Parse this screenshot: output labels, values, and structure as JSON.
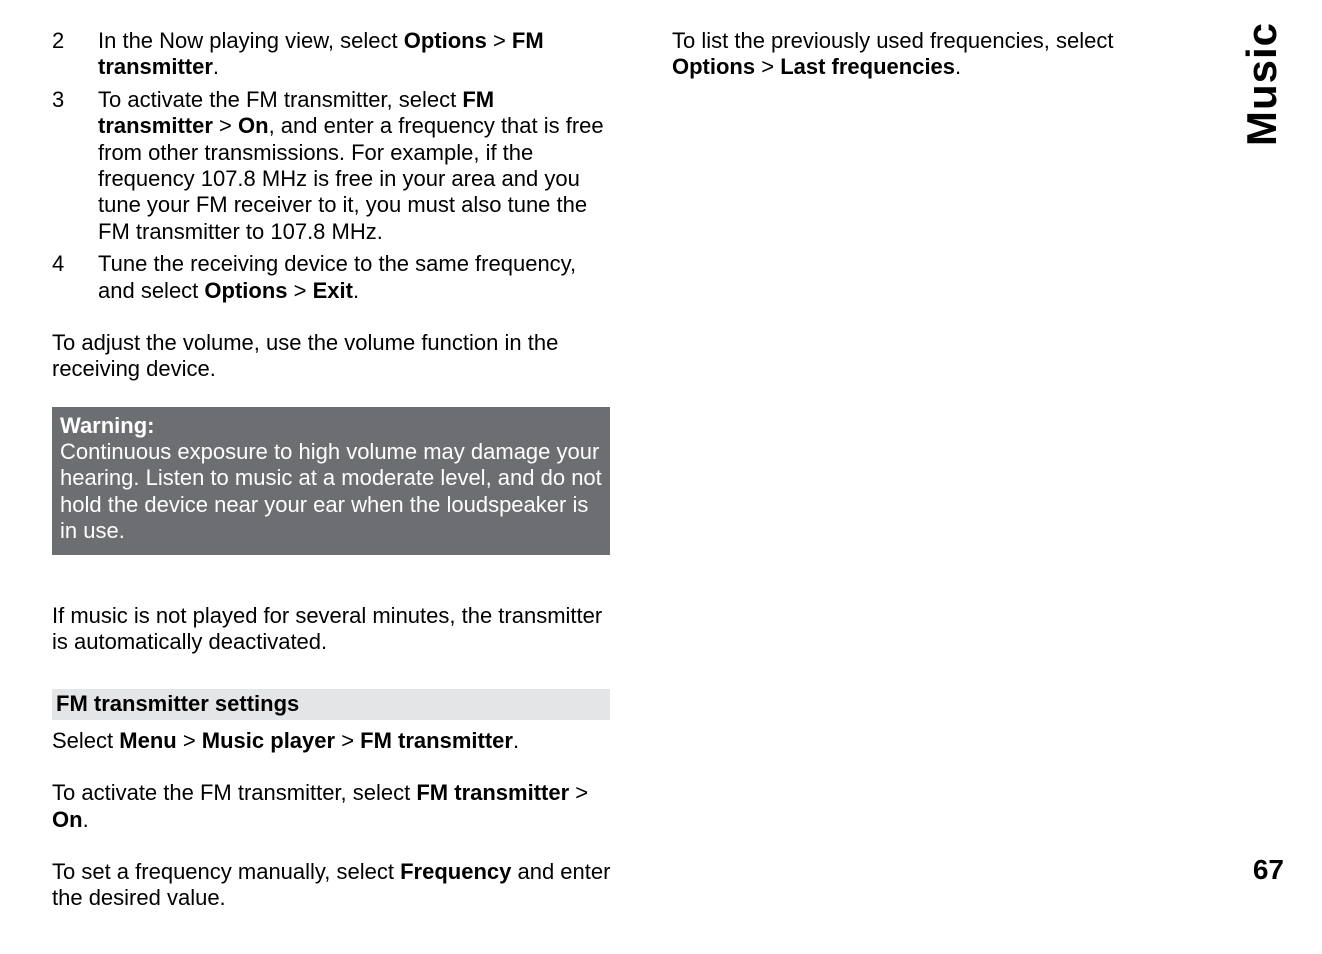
{
  "sidebar": {
    "label": "Music"
  },
  "page_number": "67",
  "left": {
    "steps": [
      {
        "n": "2",
        "pre": "In the Now playing view, select ",
        "b1": "Options",
        "mid1": " > ",
        "b2": "FM transmitter",
        "post": "."
      },
      {
        "n": "3",
        "pre": "To activate the FM transmitter, select ",
        "b1": "FM transmitter",
        "mid1": " > ",
        "b2": "On",
        "post": ", and enter a frequency that is free from other transmissions. For example, if the frequency 107.8 MHz is free in your area and you tune your FM receiver to it, you must also tune the FM transmitter to 107.8 MHz."
      },
      {
        "n": "4",
        "pre": "Tune the receiving device to the same frequency, and select ",
        "b1": "Options",
        "mid1": " > ",
        "b2": "Exit",
        "post": "."
      }
    ],
    "para_volume": "To adjust the volume, use the volume function in the receiving device.",
    "warning": {
      "title": "Warning:",
      "body": "Continuous exposure to high volume may damage your hearing. Listen to music at a moderate level, and do not hold the device near your ear when the loudspeaker is in use."
    },
    "para_deactivate": "If music is not played for several minutes, the transmitter is automatically deactivated.",
    "heading": "FM transmitter settings",
    "select_line": {
      "pre": "Select ",
      "b1": "Menu",
      "mid1": " > ",
      "b2": "Music player",
      "mid2": " > ",
      "b3": "FM transmitter",
      "post": "."
    },
    "activate_line": {
      "pre": "To activate the FM transmitter, select ",
      "b1": "FM transmitter",
      "mid1": " > ",
      "b2": "On",
      "post": "."
    },
    "freq_line": {
      "pre": "To set a frequency manually, select ",
      "b1": "Frequency",
      "post": " and enter the desired value."
    }
  },
  "right": {
    "list_line": {
      "pre": "To list the previously used frequencies, select ",
      "b1": "Options",
      "mid1": " > ",
      "b2": "Last frequencies",
      "post": "."
    }
  }
}
